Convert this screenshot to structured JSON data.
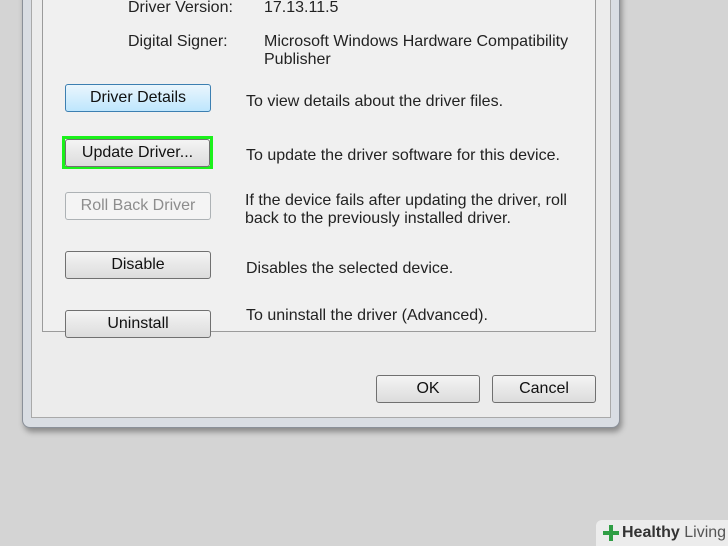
{
  "details": {
    "driver_version_label": "Driver Version:",
    "driver_version_value": "17.13.11.5",
    "digital_signer_label": "Digital Signer:",
    "digital_signer_value_line1": "Microsoft Windows Hardware Compatibility",
    "digital_signer_value_line2": "Publisher"
  },
  "actions": [
    {
      "button": "Driver Details",
      "description": "To view details about the driver files."
    },
    {
      "button": "Update Driver...",
      "description": "To update the driver software for this device."
    },
    {
      "button": "Roll Back Driver",
      "description_line1": "If the device fails after updating the driver, roll",
      "description_line2": "back to the previously installed driver."
    },
    {
      "button": "Disable",
      "description": "Disables the selected device."
    },
    {
      "button": "Uninstall",
      "description": "To uninstall the driver (Advanced)."
    }
  ],
  "footer": {
    "ok_label": "OK",
    "cancel_label": "Cancel"
  },
  "watermark": {
    "brand_bold": "Healthy",
    "brand_light": " Living"
  },
  "colors": {
    "highlight": "#1bf11b",
    "focus_border": "#3c7fb1"
  }
}
